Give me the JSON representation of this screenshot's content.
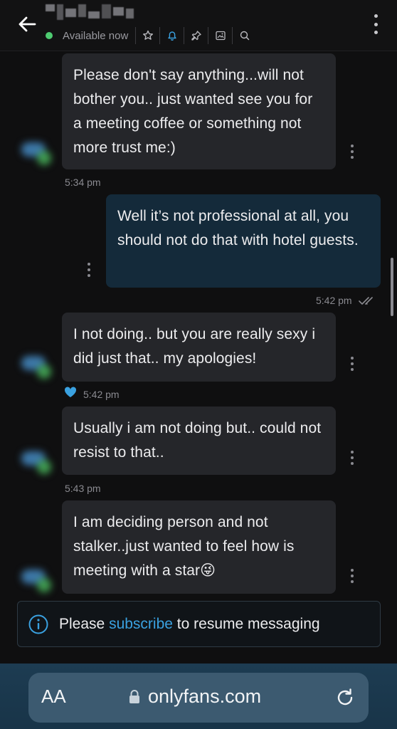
{
  "header": {
    "status": "Available now",
    "icons": [
      "star-icon",
      "bell-icon",
      "pin-icon",
      "image-icon",
      "search-icon"
    ]
  },
  "messages": [
    {
      "direction": "incoming",
      "text": "Please don't say anything...will not bother you.. just wanted see you for a meeting coffee or something not more trust me:)",
      "time": "5:34 pm"
    },
    {
      "direction": "outgoing",
      "text": "Well it’s not professional at all, you should not do that with hotel guests.",
      "time": "5:42 pm"
    },
    {
      "direction": "incoming",
      "text": "I not doing.. but you are really sexy i did just that.. my apologies!",
      "time": "5:42 pm",
      "liked": true
    },
    {
      "direction": "incoming",
      "text": "Usually i am not doing but.. could not resist to that..",
      "time": "5:43 pm"
    },
    {
      "direction": "incoming",
      "text": "I am deciding person and not stalker..just wanted to feel how is meeting with a star",
      "emoji": "😜"
    }
  ],
  "subscribe": {
    "prefix": "Please",
    "link": "subscribe",
    "suffix": "to resume messaging"
  },
  "browser": {
    "aa_label": "AA",
    "url": "onlyfans.com"
  },
  "colors": {
    "accent": "#3aa1e0",
    "online": "#4ecb71",
    "outgoing_bubble": "#142a3a",
    "incoming_bubble": "#25262a"
  }
}
